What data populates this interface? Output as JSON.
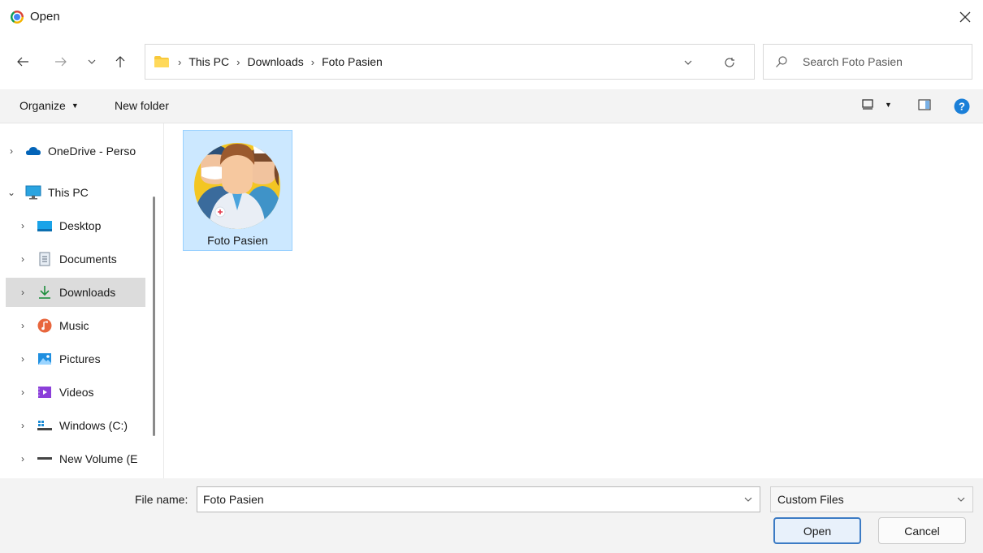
{
  "window": {
    "title": "Open"
  },
  "nav": {
    "breadcrumbs": [
      "This PC",
      "Downloads",
      "Foto Pasien"
    ],
    "search_placeholder": "Search Foto Pasien"
  },
  "toolbar": {
    "organize_label": "Organize",
    "new_folder_label": "New folder"
  },
  "sidebar": {
    "items": [
      {
        "label": "OneDrive - Perso",
        "icon": "cloud-icon"
      },
      {
        "label": "This PC",
        "icon": "monitor-icon"
      },
      {
        "label": "Desktop",
        "icon": "desktop-icon"
      },
      {
        "label": "Documents",
        "icon": "documents-icon"
      },
      {
        "label": "Downloads",
        "icon": "download-icon",
        "selected": true
      },
      {
        "label": "Music",
        "icon": "music-icon"
      },
      {
        "label": "Pictures",
        "icon": "pictures-icon"
      },
      {
        "label": "Videos",
        "icon": "videos-icon"
      },
      {
        "label": "Windows (C:)",
        "icon": "drive-icon"
      },
      {
        "label": "New Volume (E",
        "icon": "volume-icon"
      }
    ]
  },
  "files": [
    {
      "name": "Foto Pasien",
      "icon": "medical-team-thumbnail"
    }
  ],
  "footer": {
    "file_name_label": "File name:",
    "file_name_value": "Foto Pasien",
    "file_type": "Custom Files",
    "open_label": "Open",
    "cancel_label": "Cancel"
  },
  "colors": {
    "accent": "#0078d4",
    "selection": "#cce8ff",
    "primary_border": "#3c7bc4"
  }
}
